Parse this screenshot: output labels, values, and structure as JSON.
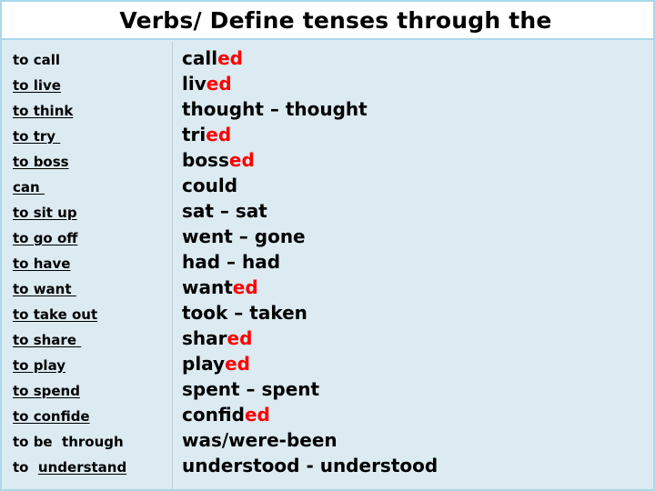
{
  "slide": {
    "title": "Verbs/ Define tenses through the",
    "background_color": "#dceaf1",
    "title_background_color": "#ffffff",
    "border_color": "#a9d8ea",
    "divider_color": "#b9cfd8",
    "text_color": "#000000",
    "suffix_color": "#ff0000"
  },
  "rows": [
    {
      "infinitive": "to call",
      "infinitive_underlined": false,
      "infinitive_underlined_part": "",
      "infinitive_plain_part": "to call",
      "form_stem": "call",
      "form_suffix": "ed",
      "form_full": "called"
    },
    {
      "infinitive": "to live",
      "infinitive_underlined": true,
      "infinitive_underlined_part": "to live",
      "infinitive_plain_part": "",
      "form_stem": "liv",
      "form_suffix": "ed",
      "form_full": "lived"
    },
    {
      "infinitive": "to think",
      "infinitive_underlined": true,
      "infinitive_underlined_part": "to think",
      "infinitive_plain_part": "",
      "form_stem": "thought – thought",
      "form_suffix": "",
      "form_full": "thought – thought"
    },
    {
      "infinitive": "to try ",
      "infinitive_underlined": true,
      "infinitive_underlined_part": "to try ",
      "infinitive_plain_part": "",
      "form_stem": "tri",
      "form_suffix": "ed",
      "form_full": "tried"
    },
    {
      "infinitive": "to boss",
      "infinitive_underlined": true,
      "infinitive_underlined_part": "to boss",
      "infinitive_plain_part": "",
      "form_stem": "boss",
      "form_suffix": "ed",
      "form_full": "bossed"
    },
    {
      "infinitive": "can ",
      "infinitive_underlined": true,
      "infinitive_underlined_part": "can ",
      "infinitive_plain_part": "",
      "form_stem": "could",
      "form_suffix": "",
      "form_full": "could"
    },
    {
      "infinitive": "to sit up",
      "infinitive_underlined": true,
      "infinitive_underlined_part": "to sit up",
      "infinitive_plain_part": "",
      "form_stem": "sat – sat",
      "form_suffix": "",
      "form_full": "sat – sat"
    },
    {
      "infinitive": "to go off",
      "infinitive_underlined": true,
      "infinitive_underlined_part": "to go off",
      "infinitive_plain_part": "",
      "form_stem": "went – gone",
      "form_suffix": "",
      "form_full": "went – gone"
    },
    {
      "infinitive": "to have",
      "infinitive_underlined": true,
      "infinitive_underlined_part": "to have",
      "infinitive_plain_part": "",
      "form_stem": "had – had",
      "form_suffix": "",
      "form_full": "had – had"
    },
    {
      "infinitive": "to want ",
      "infinitive_underlined": true,
      "infinitive_underlined_part": "to want ",
      "infinitive_plain_part": "",
      "form_stem": "want",
      "form_suffix": "ed",
      "form_full": "wanted"
    },
    {
      "infinitive": "to take out",
      "infinitive_underlined": true,
      "infinitive_underlined_part": "to take out",
      "infinitive_plain_part": "",
      "form_stem": "took – taken",
      "form_suffix": "",
      "form_full": "took – taken"
    },
    {
      "infinitive": "to share ",
      "infinitive_underlined": true,
      "infinitive_underlined_part": "to share ",
      "infinitive_plain_part": "",
      "form_stem": "shar",
      "form_suffix": "ed",
      "form_full": "shared"
    },
    {
      "infinitive": "to play",
      "infinitive_underlined": true,
      "infinitive_underlined_part": "to play",
      "infinitive_plain_part": "",
      "form_stem": "play",
      "form_suffix": "ed",
      "form_full": "played"
    },
    {
      "infinitive": "to spend",
      "infinitive_underlined": true,
      "infinitive_underlined_part": "to spend",
      "infinitive_plain_part": "",
      "form_stem": "spent – spent",
      "form_suffix": "",
      "form_full": "spent – spent"
    },
    {
      "infinitive": "to confide",
      "infinitive_underlined": true,
      "infinitive_underlined_part": "to confide",
      "infinitive_plain_part": "",
      "form_stem": "confid",
      "form_suffix": "ed",
      "form_full": "confided"
    },
    {
      "infinitive": "to be  through",
      "infinitive_underlined": false,
      "infinitive_underlined_part": "",
      "infinitive_plain_part": "to be  through",
      "form_stem": "was/were-been",
      "form_suffix": "",
      "form_full": "was/were-been"
    },
    {
      "infinitive": "to  understand",
      "infinitive_underlined": true,
      "infinitive_underlined_part": "understand",
      "infinitive_plain_part": "to  ",
      "form_stem": "understood - understood",
      "form_suffix": "",
      "form_full": "understood - understood"
    }
  ]
}
